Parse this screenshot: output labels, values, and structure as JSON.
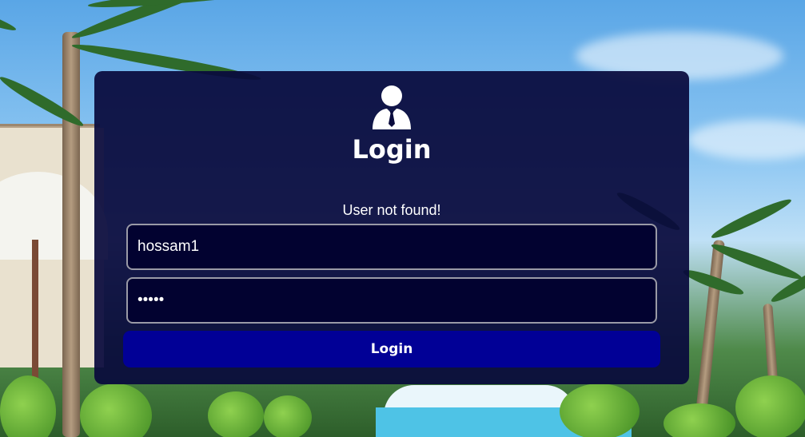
{
  "login_card": {
    "icon": "user-tie-icon",
    "title": "Login",
    "message": "User not found!",
    "username_value": "hossam1",
    "password_value": "hello",
    "submit_label": "Login"
  },
  "colors": {
    "card_background": "#090a3c",
    "input_background": "#020230",
    "button_background": "#010096",
    "text": "#ffffff"
  }
}
